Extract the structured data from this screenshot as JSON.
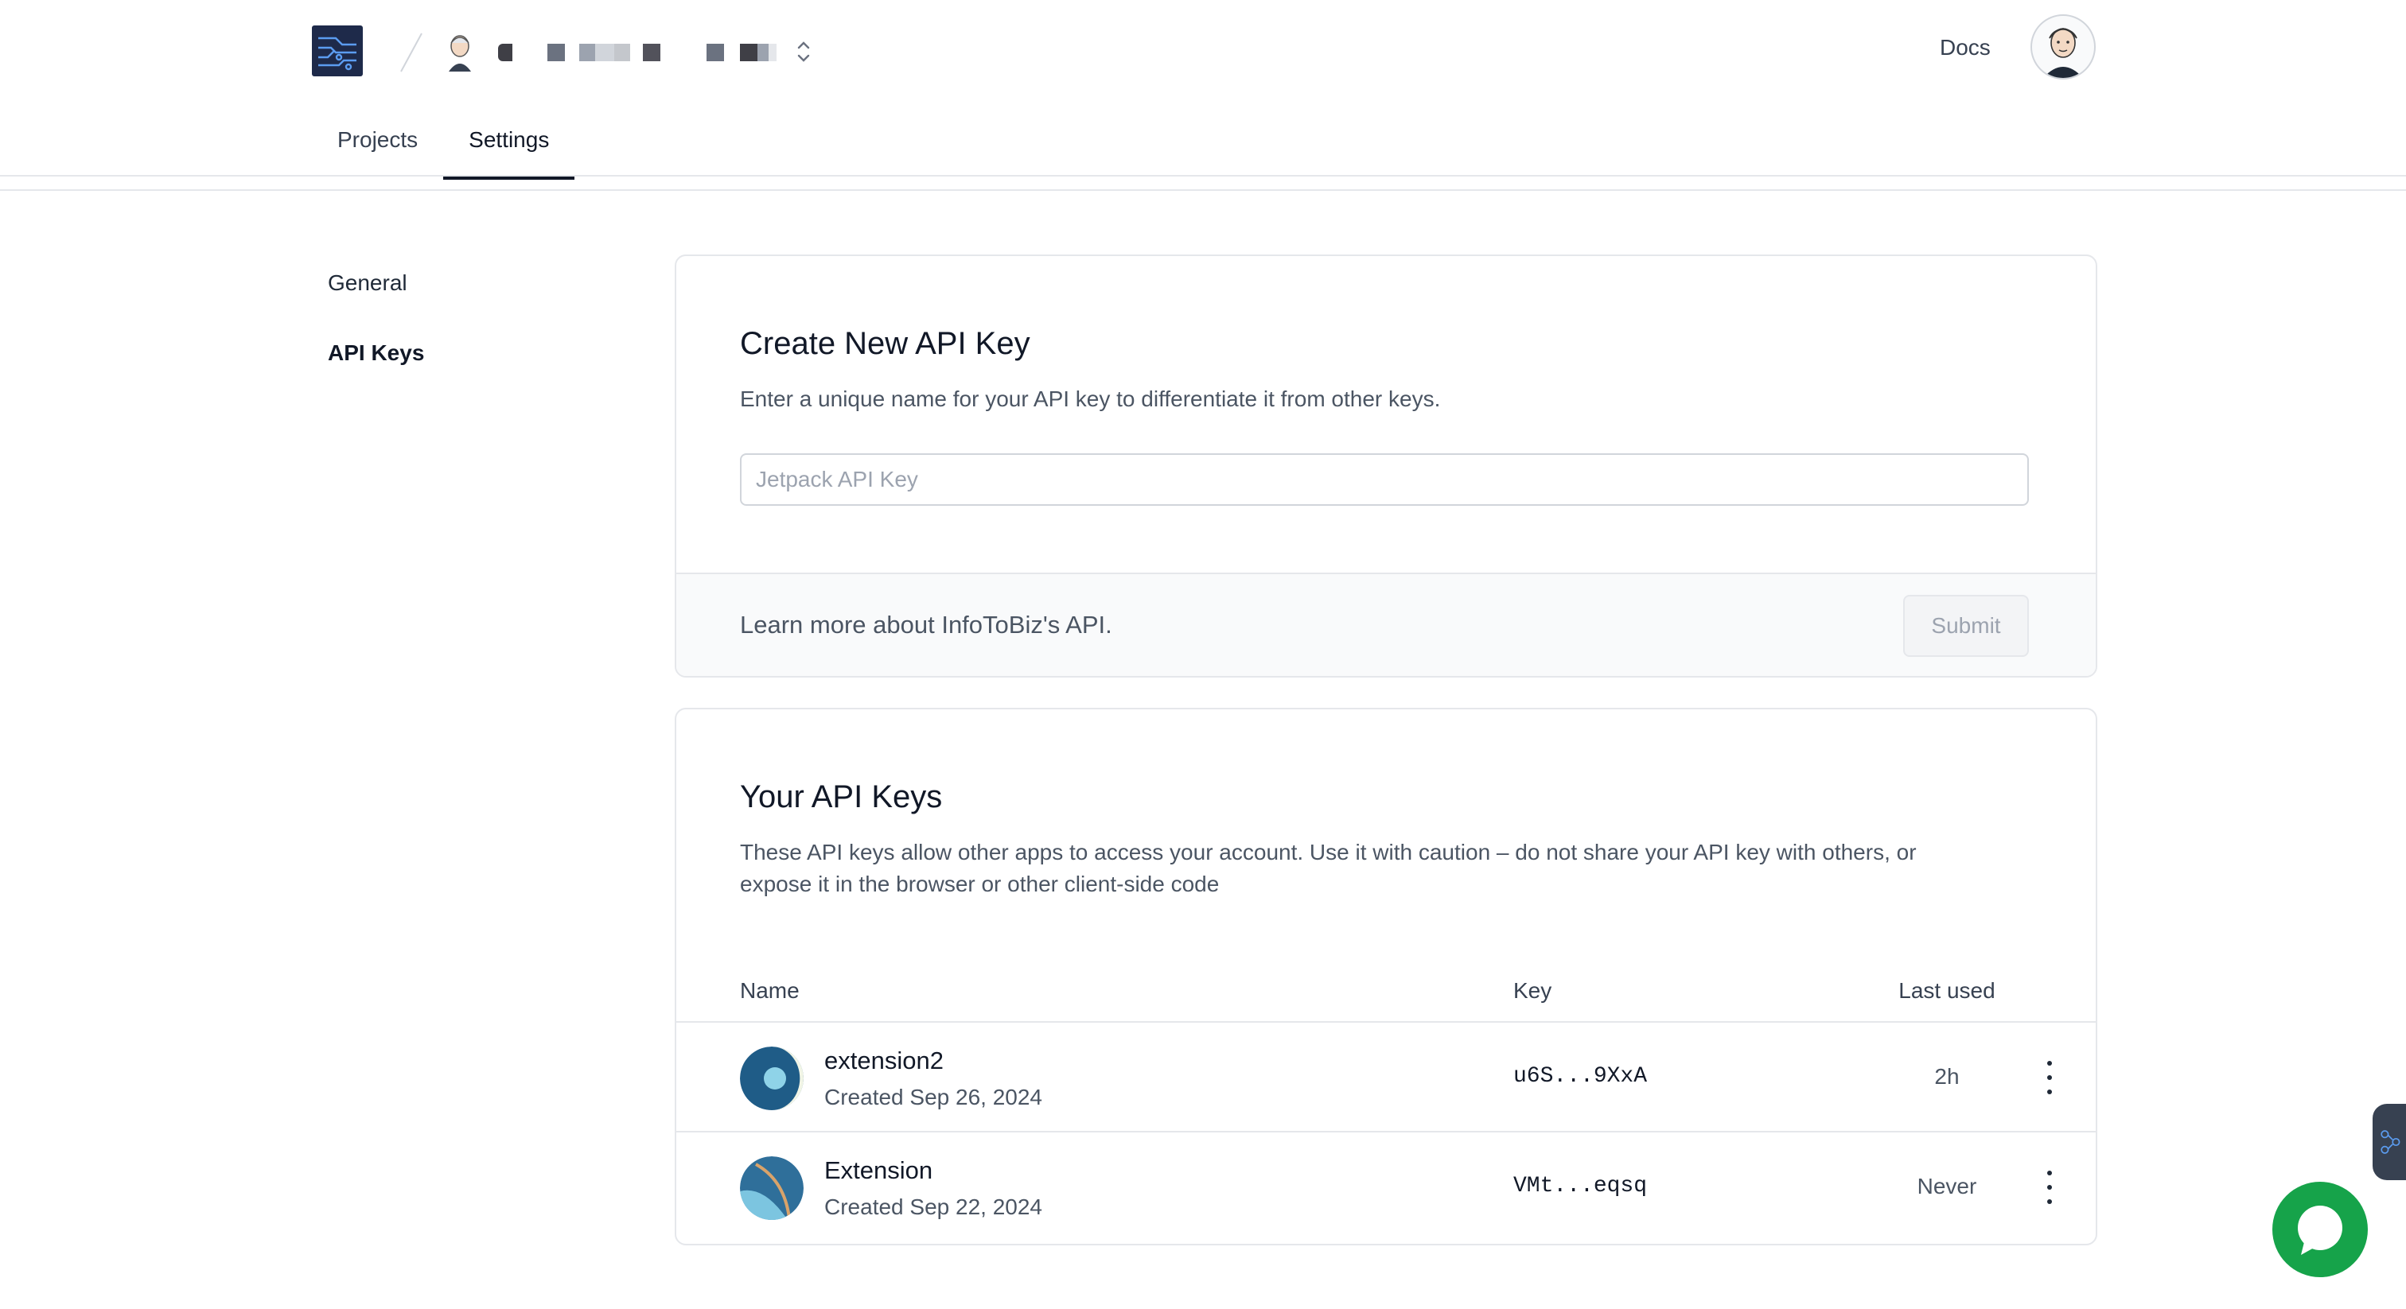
{
  "header": {
    "docs_label": "Docs"
  },
  "tabs": [
    {
      "label": "Projects"
    },
    {
      "label": "Settings"
    }
  ],
  "sidebar": {
    "items": [
      {
        "label": "General"
      },
      {
        "label": "API Keys"
      }
    ]
  },
  "create_key": {
    "title": "Create New API Key",
    "description": "Enter a unique name for your API key to differentiate it from other keys.",
    "placeholder": "Jetpack API Key",
    "learn_more": "Learn more about InfoToBiz's API.",
    "submit_label": "Submit"
  },
  "api_keys": {
    "title": "Your API Keys",
    "description": "These API keys allow other apps to access your account. Use it with caution – do not share your API key with others, or expose it in the browser or other client-side code",
    "columns": {
      "name": "Name",
      "key": "Key",
      "last_used": "Last used"
    },
    "rows": [
      {
        "name": "extension2",
        "created": "Created Sep 26, 2024",
        "key": "u6S...9XxA",
        "last_used": "2h"
      },
      {
        "name": "Extension",
        "created": "Created Sep 22, 2024",
        "key": "VMt...eqsq",
        "last_used": "Never"
      }
    ]
  },
  "colors": {
    "chat_button": "#16a34a",
    "logo_bg": "#1e2a4a"
  },
  "icons": {
    "logo": "circuit-logo-icon",
    "project_switcher": "chevron-up-down-icon",
    "row_menu": "more-vertical-icon",
    "chat": "chat-bubble-icon"
  }
}
